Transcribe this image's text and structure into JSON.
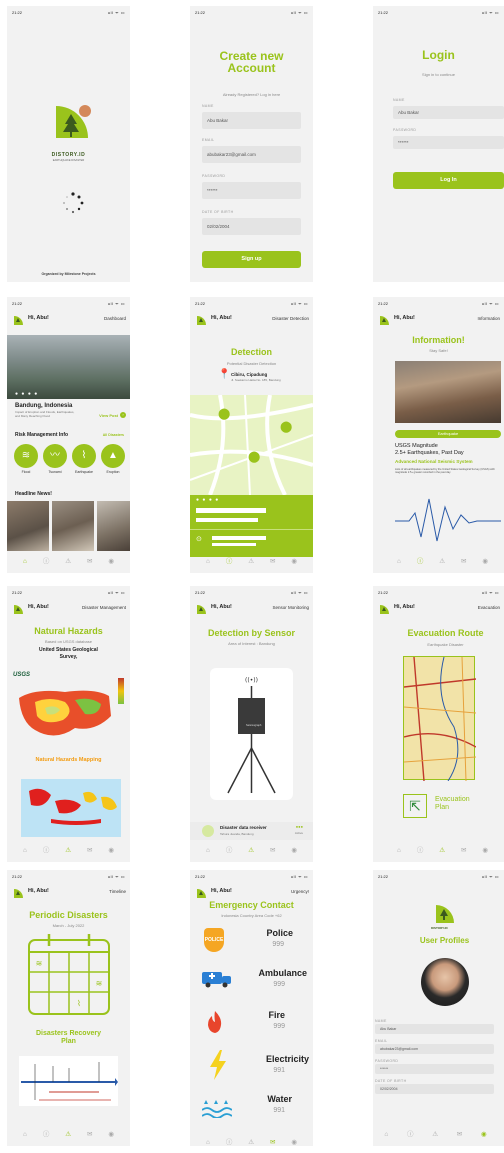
{
  "status": {
    "time": "21:22",
    "icons": "ull ᯤ ▭"
  },
  "brand": {
    "name": "DISTORY.ID",
    "tagline": "EARTHQUAKE DISASTER"
  },
  "splash": {
    "footer": "Organized by Milestone Projects"
  },
  "signup": {
    "title": "Create new Account",
    "subtitle": "Already Registered? Log in here",
    "name_label": "NAME",
    "name_value": "Abu Bakar",
    "email_label": "EMAIL",
    "email_value": "abubakar23@gmail.com",
    "password_label": "PASSWORD",
    "password_value": "******",
    "dob_label": "DATE OF BIRTH",
    "dob_value": "02/02/2004",
    "button": "Sign up"
  },
  "login": {
    "title": "Login",
    "subtitle": "Sign in to continue",
    "name_label": "NAME",
    "name_value": "Abu Bakar",
    "password_label": "PASSWORD",
    "password_value": "******",
    "button": "Log In"
  },
  "greeting": "Hi, Abu!",
  "dashboard": {
    "page": "Dashboard",
    "location": "Bandung, Indonesia",
    "location_desc": "Impact of Eruption and Floods, Earthquakes, and Many Reaching Flood",
    "view_more": "View Post",
    "risk_title": "Risk Management Info",
    "risk_all": "All Disasters",
    "risks": [
      "Flood",
      "Tsunami",
      "Earthquake",
      "Eruption"
    ],
    "headline": "Headline News!"
  },
  "detection": {
    "page": "Disaster Detection",
    "title": "Detection",
    "subtitle": "Potential Disaster Detection",
    "place": "Cibiru, Cipadung",
    "address": "Jl. Soekarno Hatta No. 185, Bandung"
  },
  "information": {
    "page": "Information",
    "title": "Information!",
    "subtitle": "Stay Safe!",
    "tag": "Earthquake",
    "usgs_line1": "USGS Magnitude",
    "usgs_line2": "2.5+ Earthquakes, Past Day",
    "system": "Advanced National Seismic System",
    "body": "Lists of all earthquakes measured by the United States Geological Survey (USGS) with magnitude 2.5+ greater recorded in the past day."
  },
  "hazards": {
    "page": "Disaster Management",
    "title": "Natural Hazards",
    "subtitle": "Based on USGS database",
    "source": "United States Geological Survey,",
    "usgs_logo": "USGS",
    "mapping": "Natural Hazards Mapping"
  },
  "sensor": {
    "page": "Sensor Monitoring",
    "title": "Detection by Sensor",
    "subtitle": "Area of Interest : Bandung",
    "device_label": "Seismograph",
    "receiver": "Disaster data receiver",
    "receiver_loc": "Tahura Juanda, Bandung",
    "status": "Active"
  },
  "evacuation": {
    "page": "Evacuation",
    "title": "Evacuation Route",
    "subtitle": "Earthquake Disaster",
    "plan": "Evacuation Plan"
  },
  "periodic": {
    "page": "Timeline",
    "title": "Periodic Disasters",
    "subtitle": "March - July 2022",
    "recovery": "Disasters Recovery Plan"
  },
  "emergency": {
    "page": "Urgency!",
    "title": "Emergency Contact",
    "subtitle": "Indonesia Country Area Code +62",
    "contacts": [
      {
        "name": "Police",
        "number": "999"
      },
      {
        "name": "Ambulance",
        "number": "999"
      },
      {
        "name": "Fire",
        "number": "999"
      },
      {
        "name": "Electricity",
        "number": "991"
      },
      {
        "name": "Water",
        "number": "991"
      }
    ]
  },
  "profile": {
    "title": "User Profiles",
    "name_label": "NAME",
    "name_value": "Abu Bakar",
    "email_label": "EMAIL",
    "email_value": "abubakar23@gmail.com",
    "password_label": "PASSWORD",
    "password_value": "******",
    "dob_label": "DATE OF BIRTH",
    "dob_value": "02/02/2004"
  },
  "nav_icons": [
    "home-icon",
    "info-icon",
    "warning-icon",
    "mail-icon",
    "profile-icon"
  ],
  "colors": {
    "accent": "#9ac31c",
    "accent_orange": "#d4895a",
    "tree": "#4a6a2a",
    "map_bg": "#e8f3c4"
  }
}
